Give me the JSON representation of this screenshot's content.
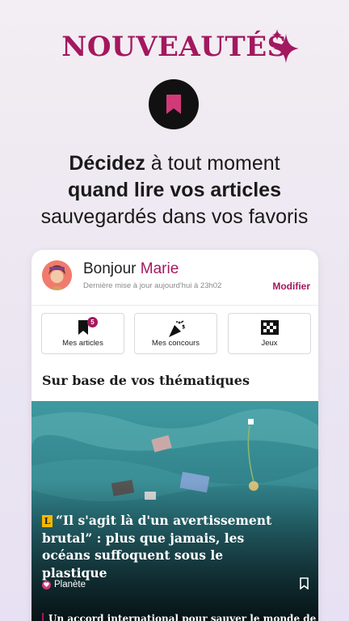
{
  "promo": {
    "title": "NOUVEAUTÉS",
    "headline_bold_1": "Décidez",
    "headline_regular_1": " à tout moment",
    "headline_bold_2": "quand lire vos articles",
    "headline_regular_2": "sauvegardés dans vos favoris"
  },
  "profile": {
    "greeting": "Bonjour",
    "name": "Marie",
    "last_update": "Dernière mise à jour aujourd'hui à 23h02",
    "modify_label": "Modifier"
  },
  "quick_actions": [
    {
      "label": "Mes articles",
      "icon": "bookmark-icon",
      "count": "5"
    },
    {
      "label": "Mes concours",
      "icon": "party-popper-icon"
    },
    {
      "label": "Jeux",
      "icon": "checkerboard-icon"
    }
  ],
  "section_title": "Sur base de vos thématiques",
  "featured_article": {
    "badge": "L",
    "title": "“Il s'agit là d'un avertissement brutal” : plus que jamais, les océans suffoquent sous le plastique",
    "topic": "Planète"
  },
  "next_article": {
    "title": "Un accord international pour sauver le monde de la"
  },
  "colors": {
    "accent": "#a3185f",
    "badge_yellow": "#f5b800",
    "ocean": "#3a8c93"
  }
}
